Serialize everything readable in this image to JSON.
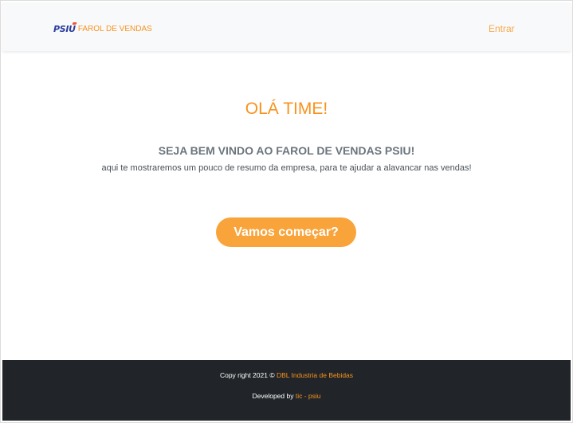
{
  "navbar": {
    "logo_text": "PSIU",
    "brand_text": "FAROL DE VENDAS",
    "login_label": "Entrar"
  },
  "hero": {
    "title": "OLÁ TIME!",
    "subtitle": "SEJA BEM VINDO AO FAROL DE VENDAS PSIU!",
    "description": "aqui te mostraremos um pouco de resumo da empresa, para te ajudar a alavancar nas vendas!",
    "cta_label": "Vamos começar?"
  },
  "footer": {
    "copyright_prefix": "Copy right 2021 © ",
    "company_link": "DBL Industria de Bebidas",
    "developed_prefix": "Developed by ",
    "developer_link": "tic - psiu"
  },
  "colors": {
    "accent": "#f7931e",
    "button": "#f9a43a",
    "navbar_bg": "#f8f9fa",
    "footer_bg": "#212529",
    "logo_blue": "#2a3c9c"
  }
}
